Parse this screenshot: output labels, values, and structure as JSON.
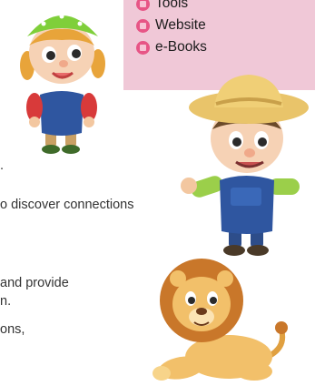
{
  "resources": {
    "items": [
      "Tools",
      "Website",
      "e-Books"
    ]
  },
  "body_text": {
    "line1": ".",
    "line2": "o discover connections",
    "line3": "and provide",
    "line4": "n.",
    "line5": "ons,"
  },
  "characters": {
    "girl": "girl-character-icon",
    "farmer_boy": "farmer-boy-character-icon",
    "lion": "lion-character-icon"
  },
  "colors": {
    "panel": "#f0c8d7",
    "bullet": "#e75586"
  }
}
